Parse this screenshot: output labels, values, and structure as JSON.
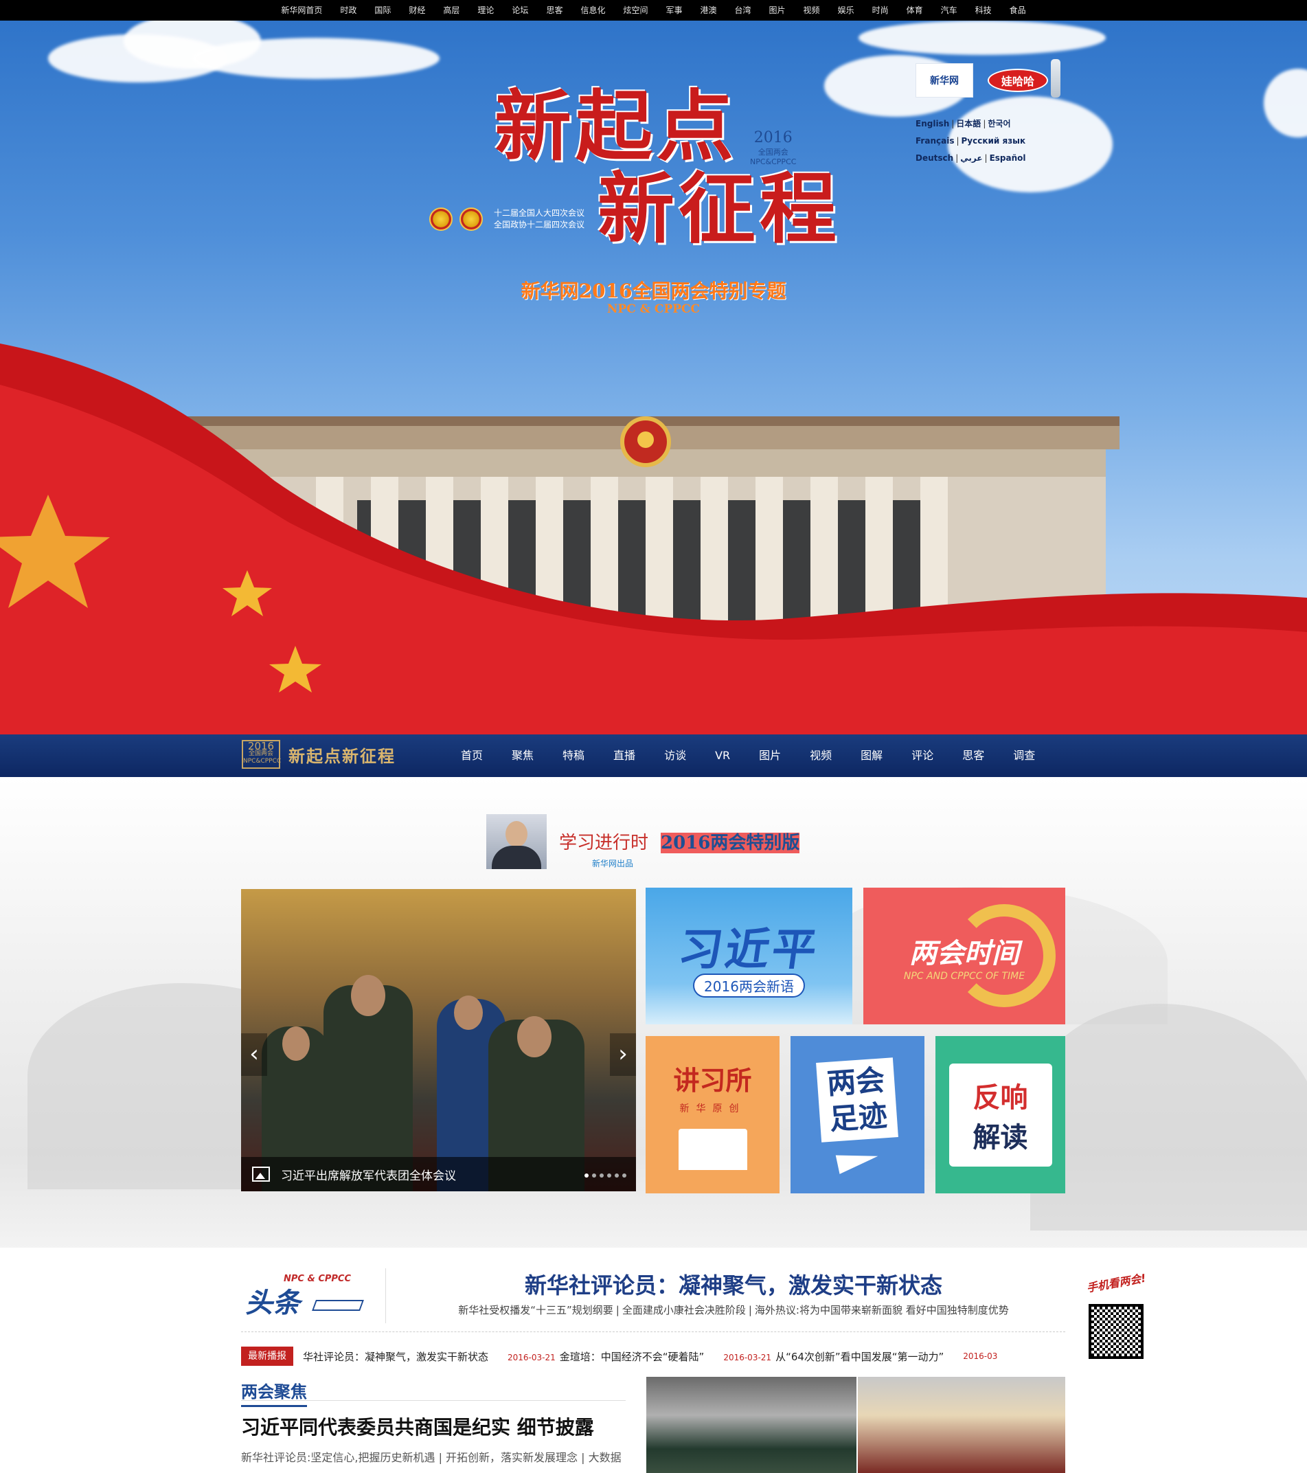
{
  "topnav": {
    "items": [
      "新华网首页",
      "时政",
      "国际",
      "财经",
      "高层",
      "理论",
      "论坛",
      "思客",
      "信息化",
      "炫空间",
      "军事",
      "港澳",
      "台湾",
      "图片",
      "视频",
      "娱乐",
      "时尚",
      "体育",
      "汽车",
      "科技",
      "食品"
    ]
  },
  "banner": {
    "title_line1": "新起点",
    "title_line2": "新征程",
    "meeting_line1": "十二届全国人大四次会议",
    "meeting_line2": "全国政协十二届四次会议",
    "logo_year": "2016",
    "logo_cn": "全国两会",
    "logo_en": "NPC&CPPCC",
    "subtitle": "新华网2016全国两会特别专题",
    "subtitle_en": "NPC & CPPCC",
    "xinhua_logo": "新华网",
    "brand_logo": "娃哈哈",
    "languages": [
      [
        "English",
        "日本語",
        "한국어"
      ],
      [
        "Français",
        "Русский язык"
      ],
      [
        "Deutsch",
        "عربي",
        "Español"
      ]
    ]
  },
  "secnav": {
    "logo_year": "2016",
    "logo_cn": "全国两会",
    "logo_en": "NPC&CPPCC",
    "logo_text": "新起点新征程",
    "items": [
      "首页",
      "聚焦",
      "特稿",
      "直播",
      "访谈",
      "VR",
      "图片",
      "视频",
      "图解",
      "评论",
      "思客",
      "调查"
    ]
  },
  "xuexi": {
    "title_a": "学习进行时",
    "title_b": "2016两会特别版",
    "sub": "新华网出品",
    "carousel_caption": "习近平出席解放军代表团全体会议",
    "carousel_prev": "‹",
    "carousel_next": "›",
    "tiles": {
      "t1_big": "习近平",
      "t1_pill": "2016两会新语",
      "t2_big": "两会时间",
      "t2_en": "NPC AND CPPCC OF TIME",
      "t3_big": "讲习所",
      "t3_sm": "新华原创",
      "t4_big_1": "两会",
      "t4_big_2": "足迹",
      "t5_r": "反响",
      "t5_b": "解读"
    }
  },
  "headline": {
    "label_npc": "NPC & CPPCC",
    "label_tt": "头条",
    "title": "新华社评论员：凝神聚气，激发实干新状态",
    "links": [
      "新华社受权播发“十三五”规划纲要",
      "全面建成小康社会决胜阶段",
      "海外热议:将为中国带来崭新面貌 看好中国独特制度优势"
    ],
    "ticker_badge": "最新播报",
    "ticker": [
      {
        "date": "",
        "text": "华社评论员：凝神聚气，激发实干新状态"
      },
      {
        "date": "2016-03-21",
        "text": "金瑄培：中国经济不会“硬着陆”"
      },
      {
        "date": "2016-03-21",
        "text": "从“64次创新”看中国发展“第一动力”"
      },
      {
        "date": "2016-03",
        "text": ""
      }
    ],
    "qr_hand": "手机看两会!",
    "focus_label": "两会聚焦",
    "focus_title": "习近平同代表委员共商国是纪实 细节披露",
    "focus_sub": "新华社评论员:坚定信心,把握历史新机遇 | 开拓创新，落实新发展理念 | 大数据"
  }
}
